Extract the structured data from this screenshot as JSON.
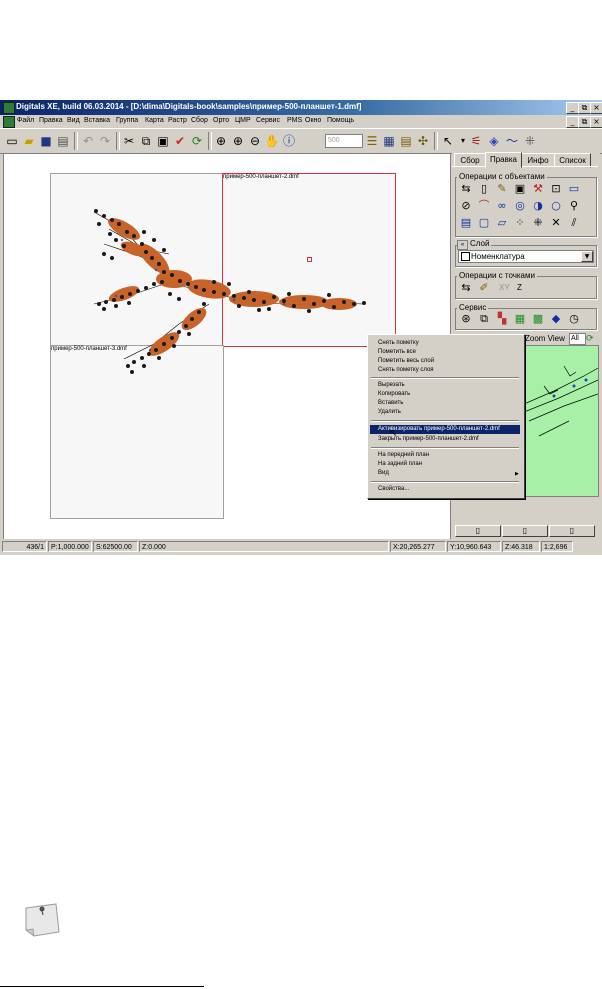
{
  "window": {
    "title": "Digitals XE, build 06.03.2014 - [D:\\dima\\Digitals-book\\samples\\пример-500-планшет-1.dmf]",
    "controls": [
      "_",
      "⧉",
      "×"
    ]
  },
  "menubar": [
    "Файл",
    "Правка",
    "Вид",
    "Вставка",
    "Группа",
    "Карта",
    "Растр",
    "Сбор",
    "Орто",
    "ЦМР",
    "Сервис",
    "PMS",
    "Окно",
    "Помощь"
  ],
  "toolbar": {
    "zoom_value": "500"
  },
  "map": {
    "sheets": [
      {
        "label": "пример-500-планшет-2.dmf"
      },
      {
        "label": "пример-500-планшет-3.dmf"
      }
    ]
  },
  "panel": {
    "tabs": [
      "Сбор",
      "Правка",
      "Инфо",
      "Список"
    ],
    "active_tab": "Правка",
    "group_objects": "Операции с объектами",
    "group_layer": "Слой",
    "layer_value": "Номенклатура",
    "group_points": "Операции с точками",
    "points_xy": "XY",
    "points_z": "Z",
    "group_service": "Сервис",
    "zoom_view": "Zoom View",
    "zoom_view_option": "All"
  },
  "context_menu": {
    "items": [
      "Снять пометку",
      "Пометить все",
      "Пометить весь слой",
      "Снять пометку слоя",
      "Вырезать",
      "Копировать",
      "Вставить",
      "Удалить",
      "Активизировать пример-500-планшет-2.dmf",
      "Закрыть пример-500-планшет-2.dmf",
      "На передний план",
      "На задний план",
      "Вид",
      "Свойства..."
    ],
    "highlighted": "Активизировать пример-500-планшет-2.dmf"
  },
  "statusbar": {
    "count": "436/1",
    "p": "P:1,000.000",
    "s": "S:62500.00",
    "z": "Z:0.000",
    "x": "X:20,265.277",
    "y": "Y:10,960.643",
    "z2": "Z:46.318",
    "scale": "1:2,696"
  },
  "colors": {
    "titlebar": "#0a246a",
    "map_objects": "#c8642a",
    "map_points": "#1a1a1a",
    "active_sheet_border": "#e0303a",
    "zoom_view_bg": "#a8f0a8"
  }
}
